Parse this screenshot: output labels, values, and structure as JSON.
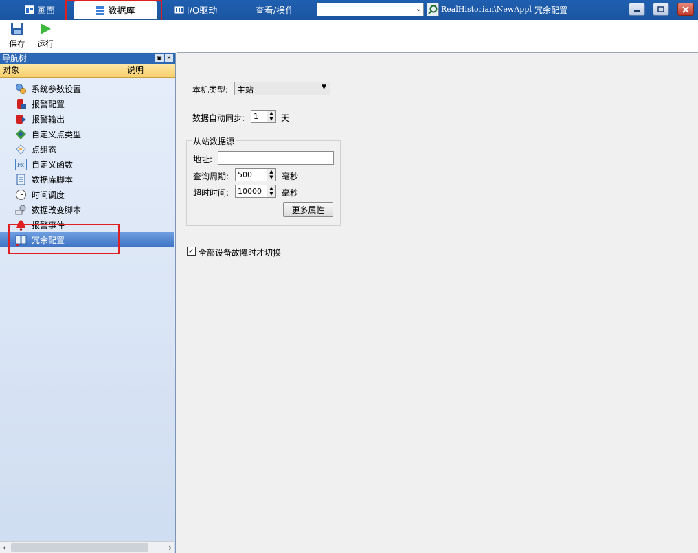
{
  "topbar": {
    "tabs": [
      {
        "label": "画面",
        "icon": "screen-icon"
      },
      {
        "label": "数据库",
        "icon": "database-icon",
        "active": true
      },
      {
        "label": "I/O驱动",
        "icon": "io-driver-icon"
      },
      {
        "label": "查看/操作"
      }
    ],
    "path": "RealHistorian\\NewAppl",
    "title": "冗余配置",
    "colors": {
      "bar": "#1f5fb0",
      "highlight": "#e02020"
    }
  },
  "toolbar": {
    "save_label": "保存",
    "run_label": "运行"
  },
  "nav": {
    "title": "导航树",
    "col_object": "对象",
    "col_desc": "说明",
    "items": [
      {
        "label": "系统参数设置",
        "icon": "gears-icon"
      },
      {
        "label": "报警配置",
        "icon": "alarm-config-icon"
      },
      {
        "label": "报警输出",
        "icon": "alarm-output-icon"
      },
      {
        "label": "自定义点类型",
        "icon": "custom-point-type-icon"
      },
      {
        "label": "点组态",
        "icon": "point-config-icon"
      },
      {
        "label": "自定义函数",
        "icon": "function-fx-icon"
      },
      {
        "label": "数据库脚本",
        "icon": "script-icon"
      },
      {
        "label": "时间调度",
        "icon": "clock-icon"
      },
      {
        "label": "数据改变脚本",
        "icon": "data-change-script-icon"
      },
      {
        "label": "报警事件",
        "icon": "alarm-bell-icon"
      },
      {
        "label": "冗余配置",
        "icon": "redundancy-icon",
        "selected": true
      }
    ]
  },
  "form": {
    "host_type_label": "本机类型:",
    "host_type_value": "主站",
    "sync_label": "数据自动同步:",
    "sync_value": "1",
    "sync_unit": "天",
    "group_title": "从站数据源",
    "address_label": "地址:",
    "address_value": "",
    "poll_label": "查询周期:",
    "poll_value": "500",
    "poll_unit": "毫秒",
    "timeout_label": "超时时间:",
    "timeout_value": "10000",
    "timeout_unit": "毫秒",
    "more_button": "更多属性",
    "checkbox_label": "全部设备故障时才切换",
    "checkbox_checked": true
  }
}
